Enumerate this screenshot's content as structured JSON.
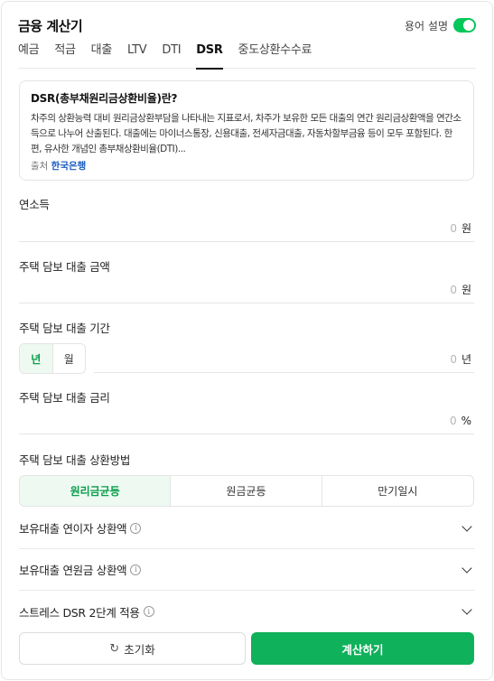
{
  "header": {
    "title": "금융 계산기",
    "glossary_label": "용어 설명",
    "glossary_on": true
  },
  "tabs": [
    {
      "label": "예금",
      "active": false
    },
    {
      "label": "적금",
      "active": false
    },
    {
      "label": "대출",
      "active": false
    },
    {
      "label": "LTV",
      "active": false
    },
    {
      "label": "DTI",
      "active": false
    },
    {
      "label": "DSR",
      "active": true
    },
    {
      "label": "중도상환수수료",
      "active": false
    }
  ],
  "info": {
    "title": "DSR(총부채원리금상환비율)란?",
    "body": "차주의 상환능력 대비 원리금상환부담을 나타내는 지표로서, 차주가 보유한 모든 대출의 연간 원리금상환액을 연간소득으로 나누어 산출된다. 대출에는 마이너스통장, 신용대출, 전세자금대출, 자동차할부금융 등이 모두 포함된다. 한편, 유사한 개념인 총부채상환비율(DTI)...",
    "source_label": "출처",
    "source_link": "한국은행"
  },
  "fields": {
    "income": {
      "label": "연소득",
      "value": "0",
      "unit": "원"
    },
    "loan_amount": {
      "label": "주택 담보 대출 금액",
      "value": "0",
      "unit": "원"
    },
    "loan_period": {
      "label": "주택 담보 대출 기간",
      "value": "0",
      "unit": "년",
      "unit_options": [
        "년",
        "월"
      ],
      "selected_unit": "년"
    },
    "interest_rate": {
      "label": "주택 담보 대출 금리",
      "value": "0",
      "unit": "%"
    },
    "repayment": {
      "label": "주택 담보 대출 상환방법",
      "options": [
        "원리금균등",
        "원금균등",
        "만기일시"
      ],
      "selected": "원리금균등"
    }
  },
  "accordions": [
    {
      "label": "보유대출 연이자 상환액"
    },
    {
      "label": "보유대출 연원금 상환액"
    },
    {
      "label": "스트레스 DSR 2단계 적용"
    }
  ],
  "buttons": {
    "reset": "초기화",
    "calculate": "계산하기"
  },
  "colors": {
    "accent": "#03c75a",
    "button": "#0fb15a",
    "link": "#1a5bbf"
  }
}
